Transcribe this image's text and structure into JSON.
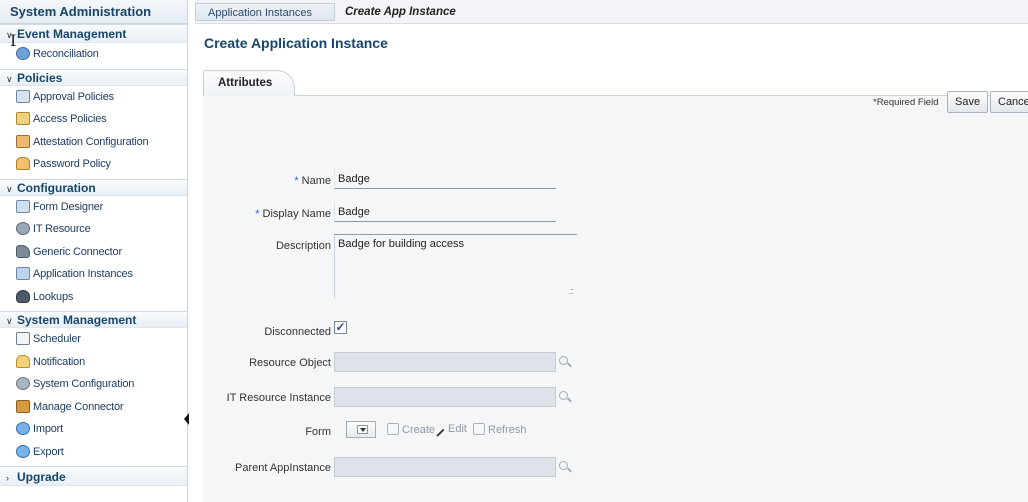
{
  "sidebar": {
    "title": "System Administration",
    "sections": [
      {
        "label": "Event Management",
        "items": [
          {
            "label": "Reconciliation",
            "icon": "reconciliation-icon"
          }
        ]
      },
      {
        "label": "Policies",
        "items": [
          {
            "label": "Approval Policies",
            "icon": "approval-policies-icon"
          },
          {
            "label": "Access Policies",
            "icon": "access-policies-icon"
          },
          {
            "label": "Attestation Configuration",
            "icon": "attestation-icon"
          },
          {
            "label": "Password Policy",
            "icon": "password-policy-icon"
          }
        ]
      },
      {
        "label": "Configuration",
        "items": [
          {
            "label": "Form Designer",
            "icon": "form-designer-icon"
          },
          {
            "label": "IT Resource",
            "icon": "it-resource-icon"
          },
          {
            "label": "Generic Connector",
            "icon": "generic-connector-icon"
          },
          {
            "label": "Application Instances",
            "icon": "application-instances-icon"
          },
          {
            "label": "Lookups",
            "icon": "lookups-icon"
          }
        ]
      },
      {
        "label": "System Management",
        "items": [
          {
            "label": "Scheduler",
            "icon": "scheduler-icon"
          },
          {
            "label": "Notification",
            "icon": "notification-icon"
          },
          {
            "label": "System Configuration",
            "icon": "system-configuration-icon"
          },
          {
            "label": "Manage Connector",
            "icon": "manage-connector-icon"
          },
          {
            "label": "Import",
            "icon": "import-icon"
          },
          {
            "label": "Export",
            "icon": "export-icon"
          }
        ]
      },
      {
        "label": "Upgrade",
        "items": []
      }
    ]
  },
  "breadcrumb": {
    "parent": "Application Instances",
    "current": "Create App Instance"
  },
  "page": {
    "title": "Create Application Instance",
    "tab": "Attributes"
  },
  "toolbar": {
    "required_note": "*Required Field",
    "save_label": "Save",
    "cancel_label": "Cancel"
  },
  "form": {
    "name": {
      "label": "Name",
      "value": "Badge",
      "required": true
    },
    "display_name": {
      "label": "Display Name",
      "value": "Badge",
      "required": true
    },
    "description": {
      "label": "Description",
      "value": "Badge for building access"
    },
    "disconnected": {
      "label": "Disconnected",
      "checked": true
    },
    "resource_object": {
      "label": "Resource Object",
      "value": ""
    },
    "it_resource_instance": {
      "label": "IT Resource Instance",
      "value": ""
    },
    "form": {
      "label": "Form",
      "create_label": "Create",
      "edit_label": "Edit",
      "refresh_label": "Refresh"
    },
    "parent_appinstance": {
      "label": "Parent AppInstance",
      "value": ""
    }
  },
  "colors": {
    "accent": "#16466b",
    "panel": "#f4f6f8",
    "required_star": "#2b6bbf"
  }
}
